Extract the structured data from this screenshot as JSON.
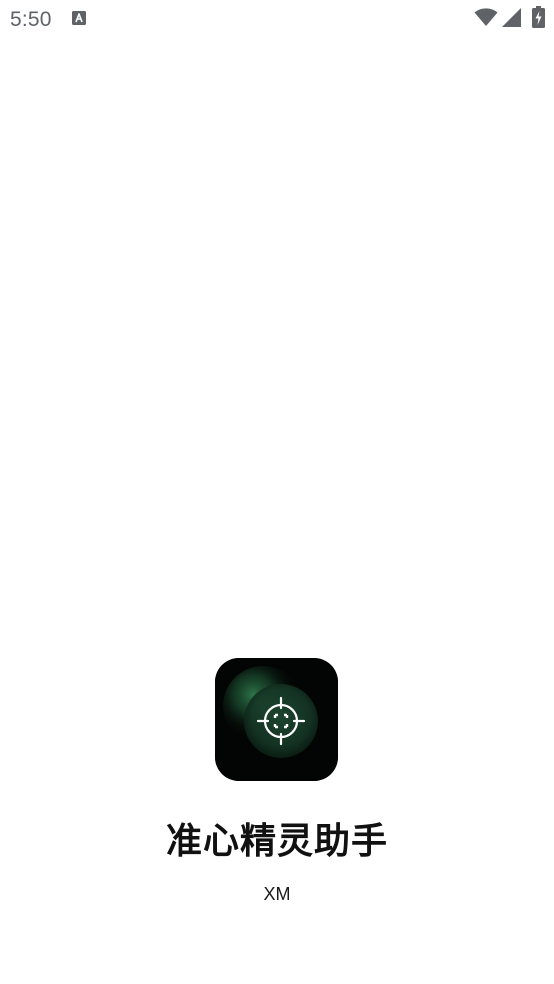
{
  "status_bar": {
    "time": "5:50",
    "notification_icon": "a-letter-notification-icon",
    "wifi_icon": "wifi-icon",
    "signal_icon": "cell-signal-icon",
    "battery_icon": "battery-charging-icon"
  },
  "splash": {
    "app_icon": "crosshair-icon",
    "app_name": "准心精灵助手",
    "developer": "XM"
  },
  "colors": {
    "icon_background": "#030504",
    "icon_glow": "#2f7a4c",
    "status_gray": "#5f6368",
    "text": "#111111"
  }
}
